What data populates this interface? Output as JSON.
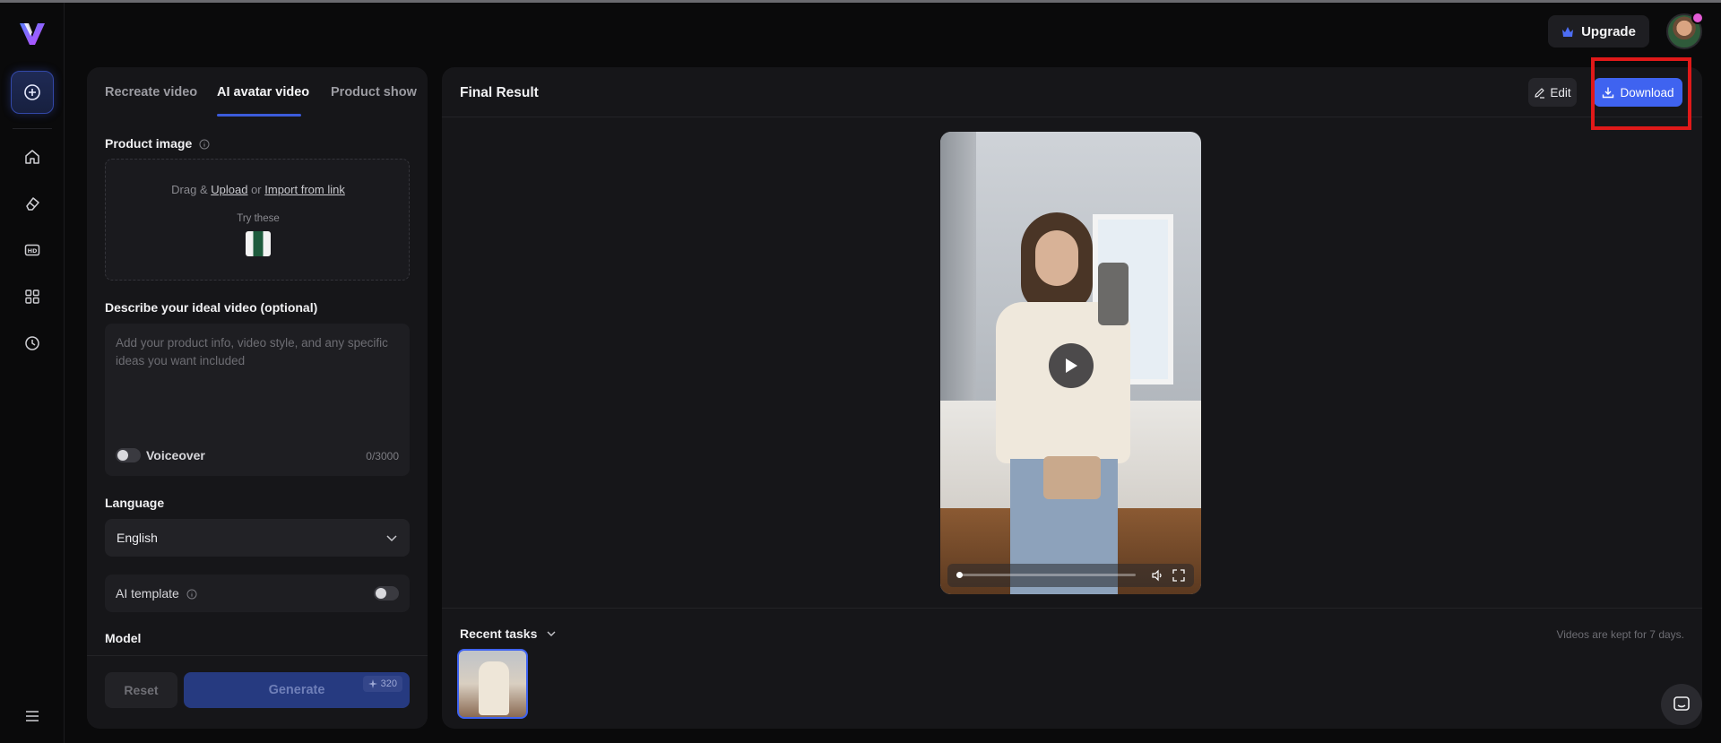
{
  "header": {
    "upgrade_label": "Upgrade"
  },
  "tabs": [
    {
      "label": "Recreate video"
    },
    {
      "label": "AI avatar video"
    },
    {
      "label": "Product show"
    }
  ],
  "form": {
    "product_image_label": "Product image",
    "upload": {
      "drag_text": "Drag &",
      "upload_link": "Upload",
      "or_text": "or",
      "import_link": "Import from link",
      "try_these": "Try these"
    },
    "describe_label": "Describe your ideal video (optional)",
    "describe_placeholder": "Add your product info, video style, and any specific ideas you want included",
    "voiceover_label": "Voiceover",
    "char_count": "0/3000",
    "language_label": "Language",
    "language_value": "English",
    "ai_template_label": "AI template",
    "model_label": "Model",
    "reset_label": "Reset",
    "generate_label": "Generate",
    "credits": "320"
  },
  "result": {
    "title": "Final Result",
    "edit_label": "Edit",
    "download_label": "Download",
    "recent_tasks_label": "Recent tasks",
    "kept_note": "Videos are kept for 7 days.",
    "video_progress": 0.0
  },
  "colors": {
    "accent": "#3f63f0",
    "highlight": "#e01919",
    "background": "#0a0a0b",
    "panel": "#161619"
  },
  "icons": [
    "logo-icon",
    "create-icon",
    "home-icon",
    "eraser-icon",
    "hd-icon",
    "apps-icon",
    "history-icon",
    "menu-icon",
    "crown-icon",
    "info-icon",
    "chevron-down-icon",
    "edit-icon",
    "download-icon",
    "play-icon",
    "volume-icon",
    "fullscreen-icon",
    "chat-icon",
    "sparkle-icon"
  ]
}
